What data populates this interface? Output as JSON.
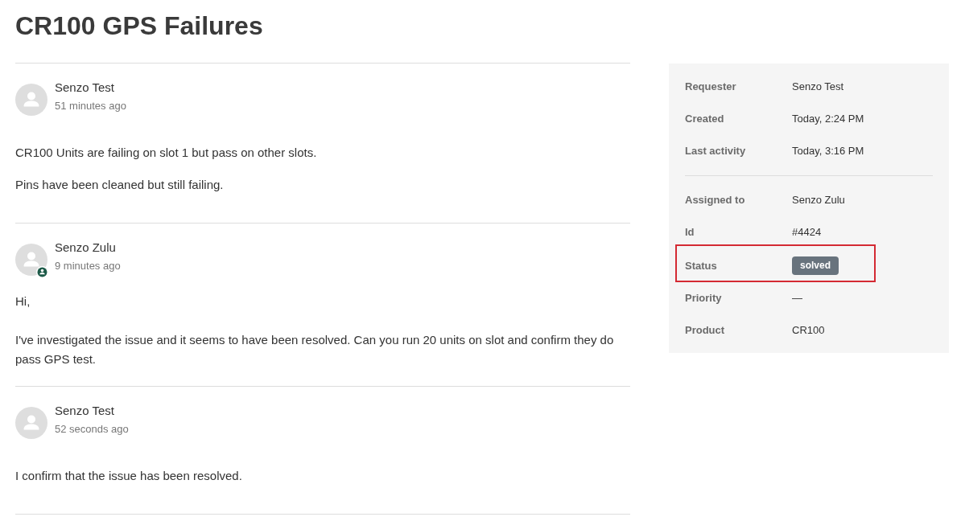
{
  "title": "CR100 GPS Failures",
  "comments": [
    {
      "author": "Senzo Test",
      "time": "51 minutes ago",
      "agent": false,
      "body": [
        "CR100 Units are failing on slot 1 but pass on other slots.",
        "Pins have been cleaned but still failing."
      ]
    },
    {
      "author": "Senzo Zulu",
      "time": "9 minutes ago",
      "agent": true,
      "body": [
        "Hi,",
        "I've investigated the issue and it seems to have been resolved. Can you run 20 units on slot and confirm they do pass GPS test."
      ]
    },
    {
      "author": "Senzo Test",
      "time": "52 seconds ago",
      "agent": false,
      "body": [
        "I confirm that the issue has been resolved."
      ]
    }
  ],
  "details": {
    "sections": [
      {
        "fields": [
          {
            "label": "Requester",
            "value": "Senzo Test",
            "kind": "text",
            "highlighted": false
          },
          {
            "label": "Created",
            "value": "Today, 2:24 PM",
            "kind": "text",
            "highlighted": false
          },
          {
            "label": "Last activity",
            "value": "Today, 3:16 PM",
            "kind": "text",
            "highlighted": false
          }
        ]
      },
      {
        "fields": [
          {
            "label": "Assigned to",
            "value": "Senzo Zulu",
            "kind": "text",
            "highlighted": false
          },
          {
            "label": "Id",
            "value": "#4424",
            "kind": "text",
            "highlighted": false
          },
          {
            "label": "Status",
            "value": "solved",
            "kind": "status",
            "highlighted": true
          },
          {
            "label": "Priority",
            "value": "—",
            "kind": "text",
            "highlighted": false
          },
          {
            "label": "Product",
            "value": "CR100",
            "kind": "text",
            "highlighted": false
          }
        ]
      }
    ]
  }
}
